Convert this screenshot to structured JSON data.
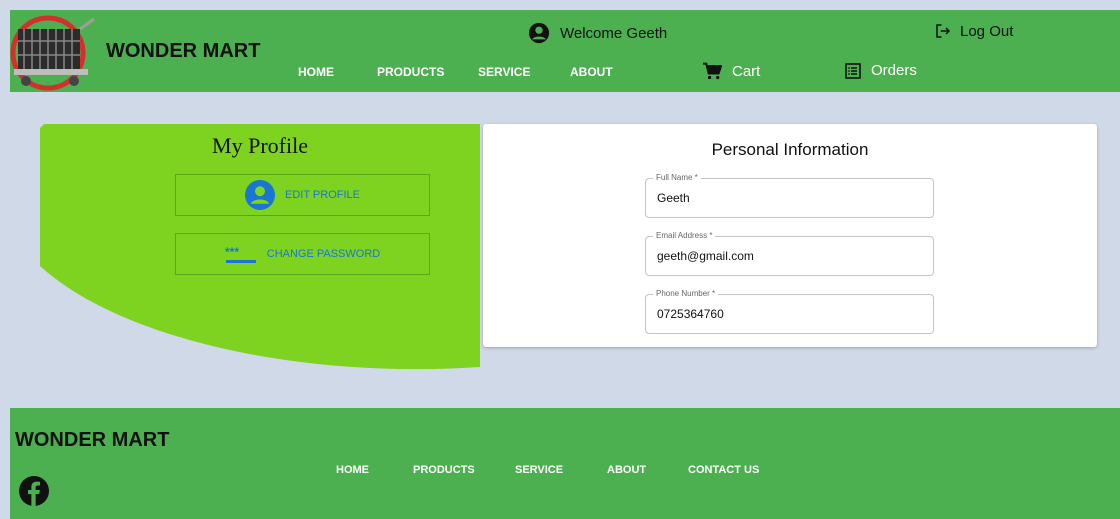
{
  "header": {
    "brand": "WONDER MART",
    "welcome": "Welcome Geeth",
    "logout": "Log Out",
    "nav": [
      "HOME",
      "PRODUCTS",
      "SERVICE",
      "ABOUT"
    ],
    "cart": "Cart",
    "orders": "Orders"
  },
  "profile": {
    "title": "My Profile",
    "edit_profile": "EDIT PROFILE",
    "change_password": "CHANGE PASSWORD"
  },
  "personal_info": {
    "title": "Personal Information",
    "fields": [
      {
        "label": "Full Name *",
        "value": "Geeth"
      },
      {
        "label": "Email Address *",
        "value": "geeth@gmail.com"
      },
      {
        "label": "Phone Number *",
        "value": "0725364760"
      }
    ]
  },
  "footer": {
    "brand": "WONDER MART",
    "nav": [
      "HOME",
      "PRODUCTS",
      "SERVICE",
      "ABOUT",
      "CONTACT US"
    ]
  },
  "colors": {
    "header_green": "#4caf50",
    "profile_green": "#7ed321",
    "page_bg": "#d0d9e8",
    "link_blue": "#1976d2"
  },
  "icons": [
    "cart-logo-icon",
    "user-circle-icon",
    "logout-icon",
    "shopping-cart-icon",
    "orders-icon",
    "account-circle-icon",
    "password-icon",
    "facebook-icon"
  ]
}
